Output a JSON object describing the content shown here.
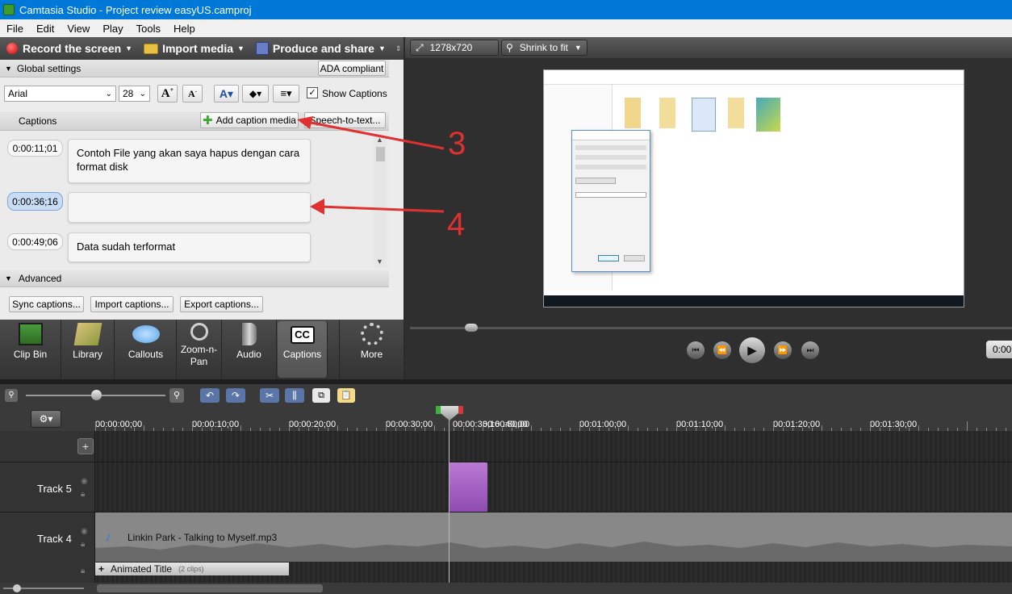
{
  "window": {
    "title": "Camtasia Studio - Project review easyUS.camproj"
  },
  "menu": [
    "File",
    "Edit",
    "View",
    "Play",
    "Tools",
    "Help"
  ],
  "toolbar": {
    "record": "Record the screen",
    "import": "Import media",
    "produce": "Produce and share"
  },
  "global_settings": {
    "header": "Global settings",
    "ada_button": "ADA compliant",
    "font_value": "Arial",
    "size_value": "28",
    "show_captions_label": "Show Captions",
    "show_captions_checked": true
  },
  "captions": {
    "header": "Captions",
    "add_button": "Add caption media",
    "speech_button": "Speech-to-text...",
    "items": [
      {
        "time": "0:00:11;01",
        "text": "Contoh File yang akan saya hapus dengan cara format disk",
        "active": false
      },
      {
        "time": "0:00:36;16",
        "text": "",
        "active": true
      },
      {
        "time": "0:00:49;06",
        "text": "Data sudah terformat",
        "active": false
      }
    ]
  },
  "advanced": {
    "header": "Advanced",
    "sync": "Sync captions...",
    "import": "Import captions...",
    "export": "Export captions..."
  },
  "tabs": [
    {
      "label": "Clip Bin",
      "icon": "film-strip-icon"
    },
    {
      "label": "Library",
      "icon": "books-icon"
    },
    {
      "label": "Callouts",
      "icon": "speech-bubble-icon"
    },
    {
      "label": "Zoom-n-\nPan",
      "icon": "magnifier-icon"
    },
    {
      "label": "Audio",
      "icon": "speaker-icon"
    },
    {
      "label": "Captions",
      "icon": "cc-icon",
      "active": true
    },
    {
      "label": "More",
      "icon": "dots-icon"
    }
  ],
  "preview": {
    "dimensions": "1278x720",
    "zoom": "Shrink to fit",
    "time_partial": "0:00"
  },
  "annotations": {
    "arrow3": "3",
    "arrow4": "4"
  },
  "timeline": {
    "ruler_labels": [
      "00:00:00;00",
      "00:00:10;00",
      "00:00:20;00",
      "00:00:30;00",
      "00:00:36;16",
      ":40;00",
      "00:00:50;00",
      "00:01:00;00",
      "00:01:10;00",
      "00:01:20;00",
      "00:01:30;00"
    ],
    "playhead_time": "00:00:36;16",
    "tracks": [
      {
        "name": "Track 5"
      },
      {
        "name": "Track 4",
        "clip": "Linkin Park - Talking to Myself.mp3"
      }
    ],
    "group": {
      "name": "Animated Title",
      "count": "(2 clips)"
    }
  },
  "colors": {
    "accent": "#0078d7",
    "caption_clip": "#9b59b6",
    "arrow": "#e03030"
  }
}
